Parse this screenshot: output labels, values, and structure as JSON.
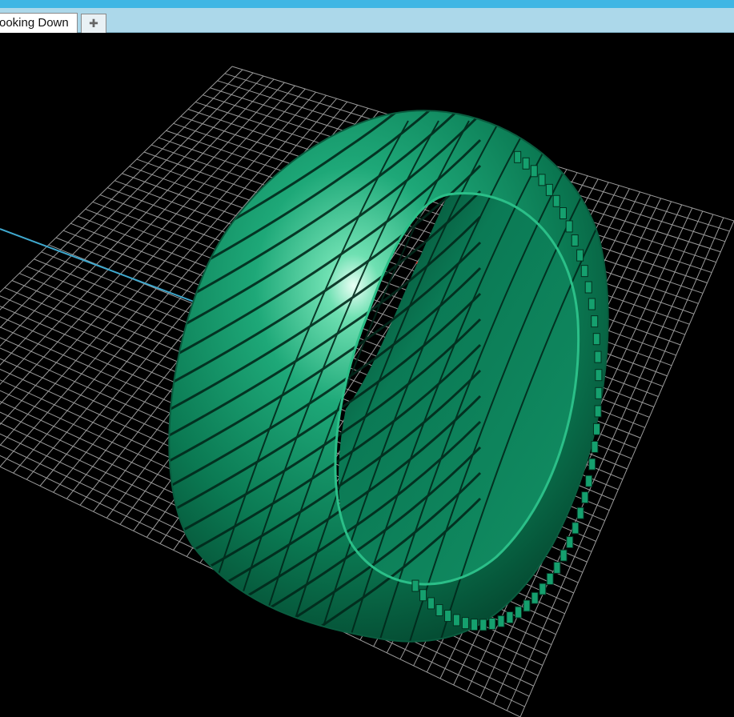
{
  "tabs": [
    {
      "label": "ooking Down",
      "active": true
    }
  ],
  "add_tab": {
    "icon": "plus-icon",
    "glyph": "✚"
  },
  "viewport": {
    "background": "#000000",
    "grid_color": "#bdbdbd",
    "axis_x_color": "#e0342a",
    "axis_y_color": "#3fa9cf",
    "model": "tire-ring",
    "model_color": "#10805a"
  },
  "colors": {
    "title_strip": "#3fb6e4",
    "tab_bar": "#acd8ea"
  }
}
